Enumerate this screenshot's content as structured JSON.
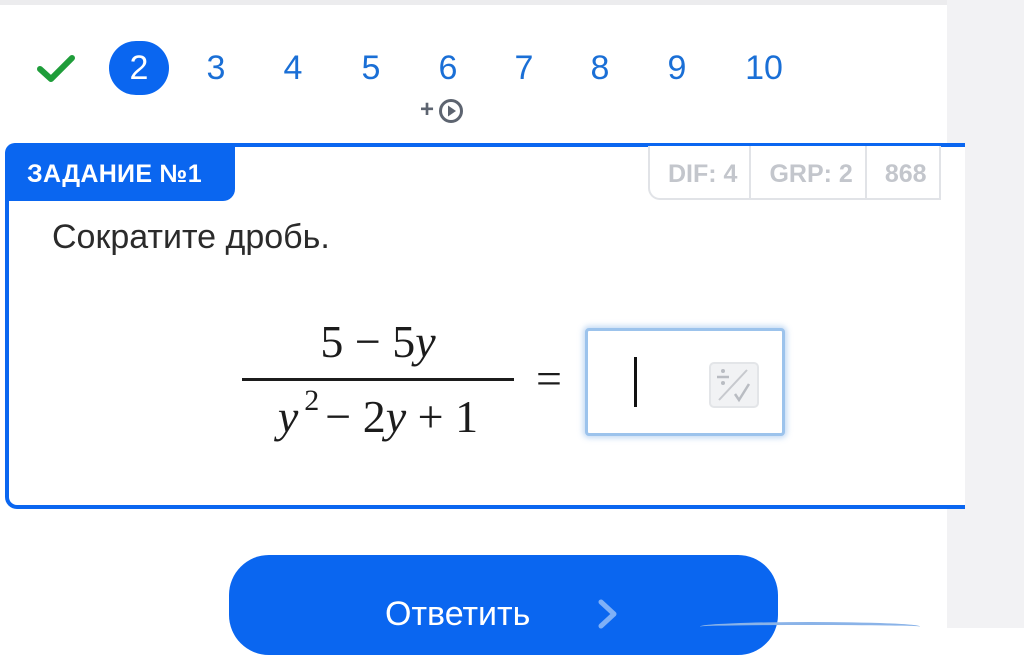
{
  "navigator": {
    "completed_icon": "check-icon",
    "active": "2",
    "items": [
      "3",
      "4",
      "5",
      "6",
      "7",
      "8",
      "9",
      "10"
    ],
    "video_badge": {
      "plus": "+",
      "icon": "play-circle-icon"
    }
  },
  "task": {
    "tag": "ЗАДАНИЕ №1",
    "meta": [
      "DIF: 4",
      "GRP: 2",
      "868"
    ],
    "prompt": "Сократите дробь.",
    "formula": {
      "numerator": "5 − 5",
      "numerator_var": "y",
      "denominator_var": "y",
      "denominator_exp": "2",
      "denominator_rest": "− 2",
      "denominator_var2": "y",
      "denominator_tail": "+ 1",
      "equals": "="
    },
    "answer": {
      "value": "",
      "tool_icon": "fraction-root-icon"
    }
  },
  "submit": {
    "label": "Ответить",
    "icon": "chevron-right-icon"
  },
  "colors": {
    "accent": "#0a66f0",
    "link": "#1a6fd6",
    "success": "#1f9d3a",
    "muted": "#c3c6cc"
  }
}
